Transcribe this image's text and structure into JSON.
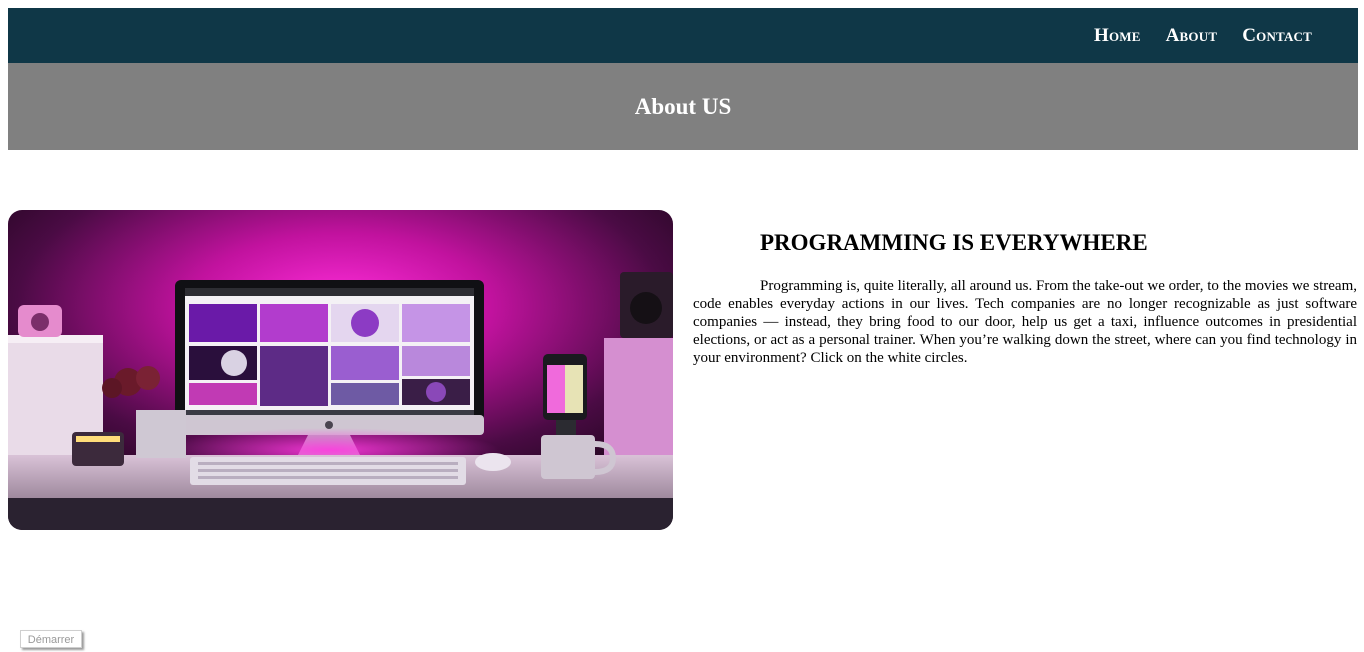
{
  "nav": {
    "links": [
      {
        "label": "Home"
      },
      {
        "label": "About"
      },
      {
        "label": "Contact"
      }
    ]
  },
  "hero": {
    "title": "About US"
  },
  "main": {
    "image_alt": "Desk with an iMac computer lit by pink and purple light",
    "heading": "PROGRAMMING IS EVERYWHERE",
    "body": "Programming is, quite literally, all around us. From the take-out we order, to the movies we stream, code enables everyday actions in our lives. Tech companies are no longer recognizable as just software companies — instead, they bring food to our door, help us get a taxi, influence outcomes in presidential elections, or act as a personal trainer. When you’re walking down the street, where can you find technology in your environment? Click on the white circles."
  },
  "footer": {
    "start_label": "Démarrer"
  },
  "colors": {
    "navbar": "#0f3747",
    "hero_band": "#808080",
    "accent_pink": "#ff1fd8"
  }
}
